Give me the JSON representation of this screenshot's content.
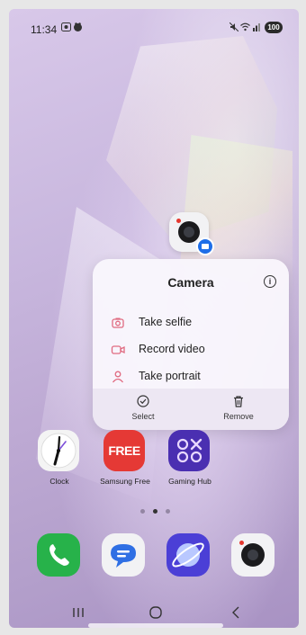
{
  "status_bar": {
    "time": "11:34",
    "battery": "100",
    "left_icons": [
      "screen-record-icon",
      "notification-icon"
    ],
    "right_icons": [
      "mute-icon",
      "wifi-icon",
      "signal-icon"
    ]
  },
  "popup": {
    "title": "Camera",
    "items": [
      {
        "label": "Take selfie",
        "icon": "camera-icon"
      },
      {
        "label": "Record video",
        "icon": "video-icon"
      },
      {
        "label": "Take portrait",
        "icon": "person-icon"
      }
    ],
    "footer": {
      "select_label": "Select",
      "remove_label": "Remove"
    }
  },
  "apps": [
    {
      "label": "Clock",
      "icon": "clock-icon"
    },
    {
      "label": "Samsung Free",
      "icon_text": "FREE"
    },
    {
      "label": "Gaming Hub",
      "icon": "gaming-hub-icon"
    }
  ],
  "page_indicator": {
    "count": 3,
    "active": 2
  },
  "dock": [
    "phone-icon",
    "messages-icon",
    "internet-icon",
    "camera-icon"
  ],
  "colors": {
    "accent_blue": "#1e6ee8",
    "free_red": "#e53935",
    "gaming_purple": "#4a2fb1",
    "phone_green": "#27b24a",
    "popup_icon_pink": "#e06a80"
  }
}
